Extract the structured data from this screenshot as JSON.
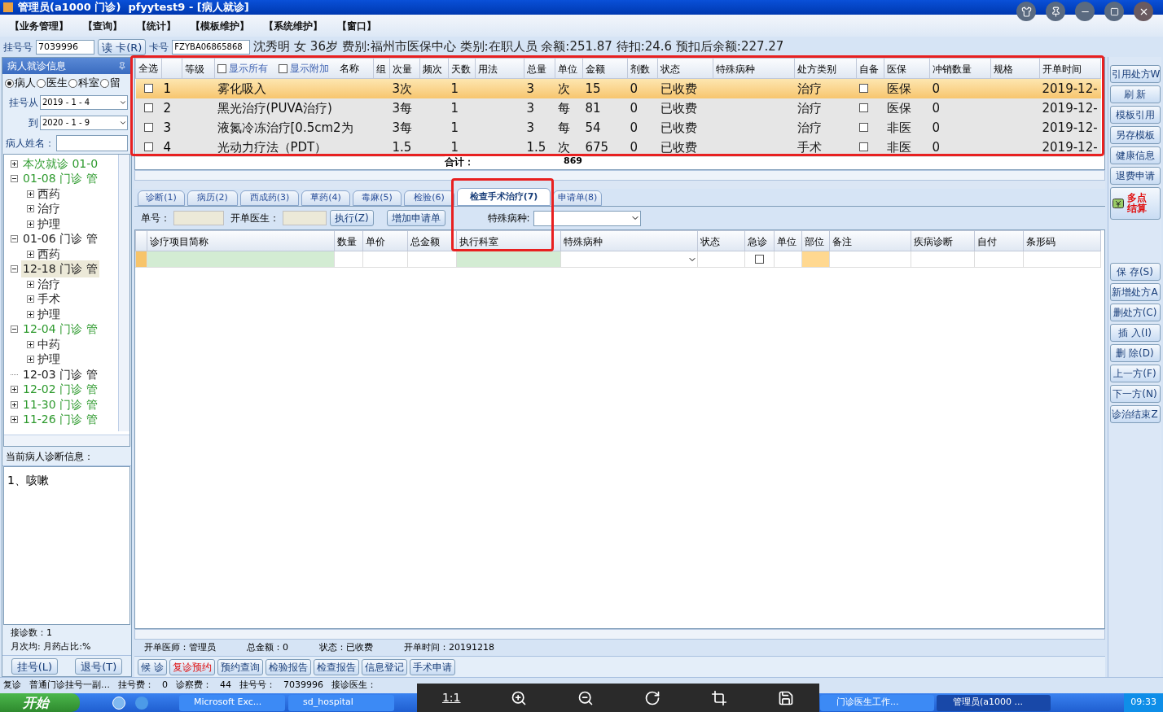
{
  "window": {
    "title": "管理员(a1000 门诊)  pfyytest9 - [病人就诊]"
  },
  "menu": [
    "【业务管理】",
    "【查询】",
    "【统计】",
    "【模板维护】",
    "【系统维护】",
    "【窗口】"
  ],
  "patient_bar": {
    "reg_label": "挂号号",
    "reg_no": "7039996",
    "read_card": "读 卡(R)",
    "card_label": "卡号",
    "card_no": "FZYBA06865868",
    "info": "沈秀明 女 36岁 费别:福州市医保中心 类别:在职人员 余额:251.87 待扣:24.6 预扣后余额:227.27"
  },
  "sidebar": {
    "title": "病人就诊信息",
    "radios": [
      {
        "label": "病人",
        "selected": true
      },
      {
        "label": "医生",
        "selected": false
      },
      {
        "label": "科室",
        "selected": false
      },
      {
        "label": "留",
        "selected": false
      }
    ],
    "from_label": "挂号从",
    "from": "2019 - 1 - 4",
    "to_label": "到",
    "to": "2020 - 1 - 9",
    "name_label": "病人姓名：",
    "tree": [
      {
        "label": "本次就诊 01-0",
        "color": "#2e9a2e",
        "kind": "folder",
        "expanded": false,
        "selected": false
      },
      {
        "label": "01-08 门诊 管",
        "color": "#2e9a2e",
        "kind": "folder",
        "expanded": true,
        "selected": false,
        "children": [
          {
            "label": "西药"
          },
          {
            "label": "治疗"
          },
          {
            "label": "护理"
          }
        ]
      },
      {
        "label": "01-06 门诊 管",
        "color": "#222222",
        "kind": "folder",
        "expanded": true,
        "selected": false,
        "children": [
          {
            "label": "西药"
          }
        ]
      },
      {
        "label": "12-18 门诊 管",
        "color": "#222222",
        "kind": "folder",
        "expanded": true,
        "selected": true,
        "children": [
          {
            "label": "治疗"
          },
          {
            "label": "手术"
          },
          {
            "label": "护理"
          }
        ]
      },
      {
        "label": "12-04 门诊 管",
        "color": "#2e9a2e",
        "kind": "folder",
        "expanded": true,
        "selected": false,
        "children": [
          {
            "label": "中药"
          },
          {
            "label": "护理"
          }
        ]
      },
      {
        "label": "12-03 门诊 管",
        "color": "#222222",
        "kind": "plain",
        "selected": false
      },
      {
        "label": "12-02 门诊 管",
        "color": "#2e9a2e",
        "kind": "folder",
        "expanded": false,
        "selected": false
      },
      {
        "label": "11-30 门诊 管",
        "color": "#2e9a2e",
        "kind": "folder",
        "expanded": false,
        "selected": false
      },
      {
        "label": "11-26 门诊 管",
        "color": "#2e9a2e",
        "kind": "folder",
        "expanded": false,
        "selected": false
      }
    ],
    "diag_title": "当前病人诊断信息：",
    "diag_text": "1、咳嗽",
    "visits": "接诊数：1",
    "ratio": "月次均: 月药占比:%",
    "buttons": [
      "挂号(L)",
      "退号(T)"
    ]
  },
  "prescriptions": {
    "select_all": "全选",
    "show_all": {
      "label": "显示所有",
      "checked": false
    },
    "show_extra": {
      "label": "显示附加",
      "checked": false
    },
    "columns": [
      "等级",
      "名称",
      "组",
      "次量",
      "频次",
      "天数",
      "用法",
      "总量",
      "单位",
      "金额",
      "剂数",
      "状态",
      "特殊病种",
      "处方类别",
      "自备",
      "医保",
      "冲销数量",
      "规格",
      "开单时间"
    ],
    "rows": [
      {
        "checked": false,
        "selected": true,
        "seq": "1",
        "name": "雾化吸入",
        "dose": "3次",
        "days": "1",
        "total": "3",
        "unit": "次",
        "amount": "15",
        "packs": "0",
        "status": "已收费",
        "category": "治疗",
        "self": false,
        "insurance": "医保",
        "writeoff": "0",
        "time": "2019-12-"
      },
      {
        "checked": false,
        "selected": false,
        "seq": "2",
        "name": "黑光治疗(PUVA治疗)",
        "dose": "3每",
        "days": "1",
        "total": "3",
        "unit": "每",
        "amount": "81",
        "packs": "0",
        "status": "已收费",
        "category": "治疗",
        "self": false,
        "insurance": "医保",
        "writeoff": "0",
        "time": "2019-12-"
      },
      {
        "checked": false,
        "selected": false,
        "seq": "3",
        "name": "液氮冷冻治疗[0.5cm2为",
        "dose": "3每",
        "days": "1",
        "total": "3",
        "unit": "每",
        "amount": "54",
        "packs": "0",
        "status": "已收费",
        "category": "治疗",
        "self": false,
        "insurance": "非医",
        "writeoff": "0",
        "time": "2019-12-"
      },
      {
        "checked": false,
        "selected": false,
        "seq": "4",
        "name": "光动力疗法（PDT）",
        "dose": "1.5",
        "days": "1",
        "total": "1.5",
        "unit": "次",
        "amount": "675",
        "packs": "0",
        "status": "已收费",
        "category": "手术",
        "self": false,
        "insurance": "非医",
        "writeoff": "0",
        "time": "2019-12-"
      }
    ],
    "total_label": "合计：",
    "total": "869"
  },
  "tabs": [
    {
      "label": "诊断(1)",
      "selected": false
    },
    {
      "label": "病历(2)",
      "selected": false
    },
    {
      "label": "西成药(3)",
      "selected": false
    },
    {
      "label": "草药(4)",
      "selected": false
    },
    {
      "label": "毒麻(5)",
      "selected": false
    },
    {
      "label": "检验(6)",
      "selected": false
    },
    {
      "label": "检查手术治疗(7)",
      "selected": true
    },
    {
      "label": "申请单(8)",
      "selected": false
    }
  ],
  "order_form": {
    "no_label": "单号：",
    "doctor_label": "开单医生：",
    "execute": "执行(Z)",
    "add": "增加申请单",
    "disease_label": "特殊病种:",
    "columns": [
      "诊疗项目简称",
      "数量",
      "单价",
      "总金额",
      "执行科室",
      "特殊病种",
      "状态",
      "急诊",
      "单位",
      "部位",
      "备注",
      "疾病诊断",
      "自付",
      "条形码"
    ],
    "new_row": {
      "urgent": false
    },
    "info": [
      "开单医师：管理员",
      "总金额：0",
      "状态：已收费",
      "开单时间：20191218"
    ]
  },
  "bottom_buttons": [
    {
      "label": "候 诊",
      "alert": false
    },
    {
      "label": "复诊预约",
      "alert": true
    },
    {
      "label": "预约查询",
      "alert": false
    },
    {
      "label": "检验报告",
      "alert": false
    },
    {
      "label": "检查报告",
      "alert": false
    },
    {
      "label": "信息登记",
      "alert": false
    },
    {
      "label": "手术申请",
      "alert": false
    }
  ],
  "side_buttons": [
    {
      "label": "引用处方W",
      "kind": "button"
    },
    {
      "label": "刷 新",
      "kind": "button"
    },
    {
      "label": "模板引用",
      "kind": "button"
    },
    {
      "label": "另存模板",
      "kind": "button"
    },
    {
      "label": "健康信息",
      "kind": "button"
    },
    {
      "label": "退费申请",
      "kind": "button"
    },
    {
      "label": "多点结算",
      "kind": "settle"
    },
    {
      "label": "保 存(S)",
      "kind": "button"
    },
    {
      "label": "新增处方A",
      "kind": "button"
    },
    {
      "label": "删处方(C)",
      "kind": "button"
    },
    {
      "label": "插 入(I)",
      "kind": "button"
    },
    {
      "label": "删 除(D)",
      "kind": "button"
    },
    {
      "label": "上一方(F)",
      "kind": "button"
    },
    {
      "label": "下一方(N)",
      "kind": "button"
    },
    {
      "label": "诊治结束Z",
      "kind": "button"
    }
  ],
  "status_bar": [
    "复诊",
    "普通门诊挂号一副…",
    "挂号费：",
    "0",
    "诊察费：",
    "44",
    "挂号号：",
    "7039996",
    "接诊医生："
  ],
  "taskbar": {
    "start": "开始",
    "items": [
      {
        "label": "Microsoft Exc...",
        "selected": false
      },
      {
        "label": "sd_hospital",
        "selected": false
      }
    ],
    "items_right": [
      {
        "label": "门诊医生工作...",
        "selected": false
      },
      {
        "label": "管理员(a1000 ...",
        "selected": true
      }
    ],
    "clock": "09:33"
  },
  "viewer_toolbar": {
    "ratio": "1:1"
  }
}
